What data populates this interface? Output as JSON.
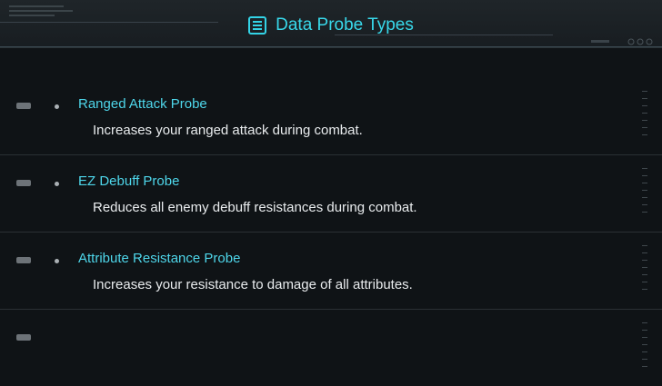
{
  "header": {
    "title": "Data Probe Types",
    "icon": "list-icon"
  },
  "probes": [
    {
      "name": "Ranged Attack Probe",
      "description": "Increases your ranged attack during combat."
    },
    {
      "name": "EZ Debuff Probe",
      "description": "Reduces all enemy debuff resistances during combat."
    },
    {
      "name": "Attribute Resistance Probe",
      "description": "Increases your resistance to damage of all attributes."
    }
  ],
  "colors": {
    "accent": "#38d8ea",
    "background": "#0f1316",
    "text": "#e9ecee"
  }
}
